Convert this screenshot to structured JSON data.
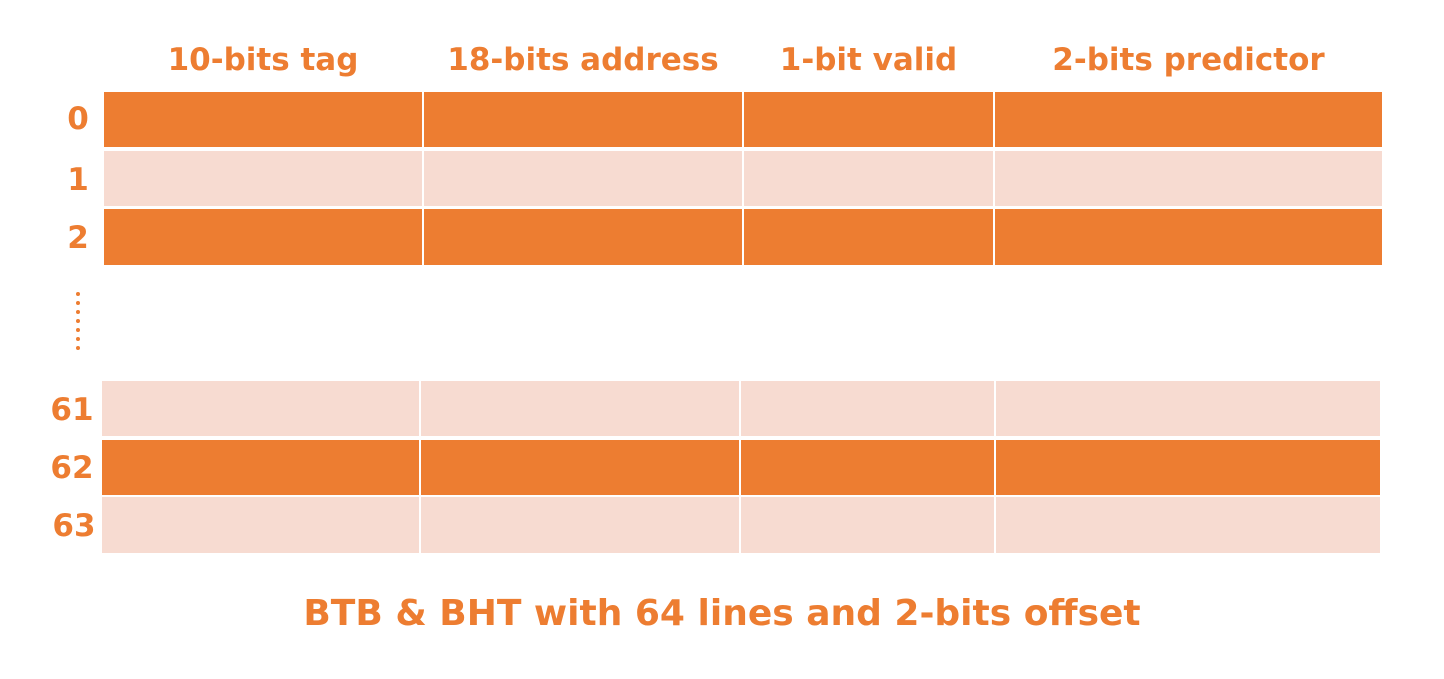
{
  "columns": [
    {
      "label": "10-bits tag"
    },
    {
      "label": "18-bits address"
    },
    {
      "label": "1-bit valid"
    },
    {
      "label": "2-bits predictor"
    }
  ],
  "rows": [
    {
      "label": "0",
      "shade": "dark"
    },
    {
      "label": "1",
      "shade": "light"
    },
    {
      "label": "2",
      "shade": "dark"
    },
    {
      "label": "61",
      "shade": "light"
    },
    {
      "label": "62",
      "shade": "dark"
    },
    {
      "label": "63",
      "shade": "light"
    }
  ],
  "caption": "BTB & BHT with 64 lines and 2-bits offset",
  "colors": {
    "accent": "#ED7D31",
    "row_light": "#F7DBD1",
    "row_dark": "#ED7D31",
    "background": "#FFFFFF"
  }
}
